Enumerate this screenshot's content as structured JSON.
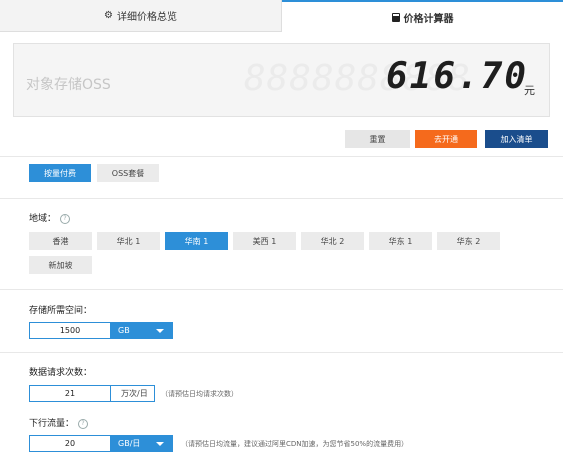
{
  "tabs": {
    "overview": {
      "icon": "gear-icon",
      "label": "详细价格总览"
    },
    "calculator": {
      "icon": "calculator-icon",
      "label": "价格计算器"
    }
  },
  "display": {
    "product": "对象存储OSS",
    "ghost_digits": "8888888888",
    "price": "616.70",
    "currency": "元"
  },
  "actions": {
    "reset": "重置",
    "open": "去开通",
    "add": "加入清单"
  },
  "billing": {
    "options": [
      "按量付费",
      "OSS套餐"
    ],
    "selected": "按量付费"
  },
  "region": {
    "label": "地域：",
    "options": [
      "香港",
      "华北 1",
      "华南 1",
      "美西 1",
      "华北 2",
      "华东 1",
      "华东 2",
      "新加坡"
    ],
    "selected": "华南 1"
  },
  "storage": {
    "label": "存储所需空间：",
    "value": "1500",
    "unit": "GB"
  },
  "requests": {
    "label": "数据请求次数：",
    "value": "21",
    "unit": "万次/日",
    "hint": "（请预估日均请求次数）"
  },
  "downstream": {
    "label": "下行流量：",
    "value": "20",
    "unit": "GB/日",
    "hint": "（请预估日均流量，建议通过阿里CDN加速，为您节省50%的流量费用）"
  },
  "colors": {
    "accent": "#2d8fd8",
    "open_button": "#f56a1c",
    "add_button": "#1a4d8c"
  }
}
